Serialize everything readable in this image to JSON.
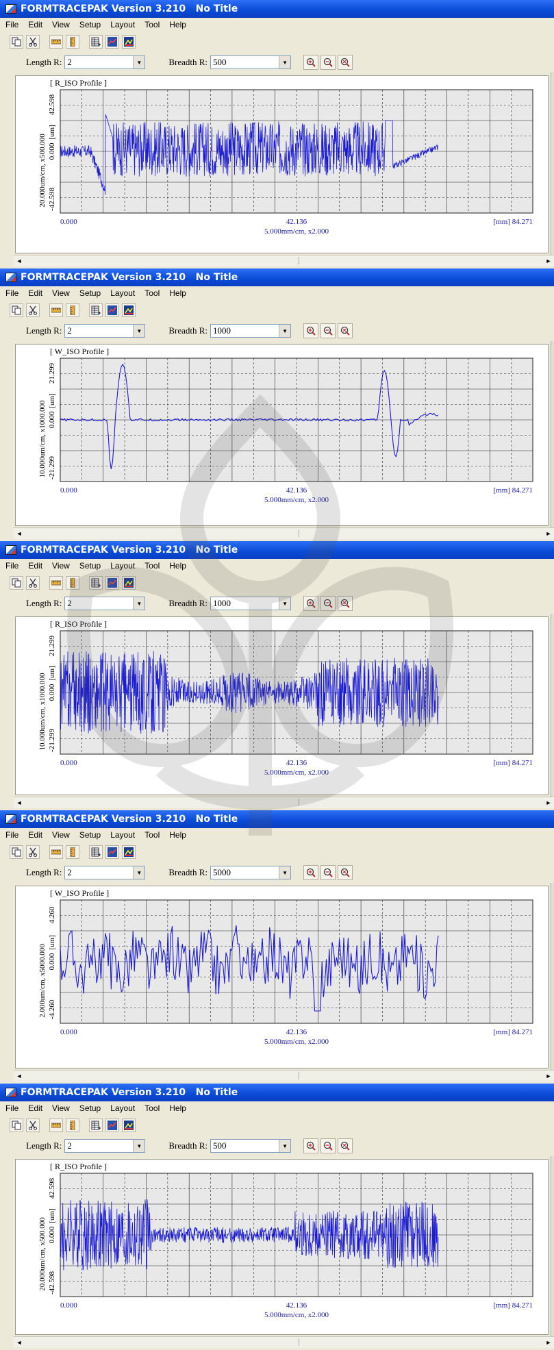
{
  "app": {
    "title": "FORMTRACEPAK Version 3.210   No Title",
    "menu": [
      "File",
      "Edit",
      "View",
      "Setup",
      "Layout",
      "Tool",
      "Help"
    ],
    "length_label": "Length R:",
    "breadth_label": "Breadth R:",
    "toolbar_icons": [
      "copy-icon",
      "cut-icon",
      "ruler-icon",
      "column-icon",
      "table-icon",
      "chart-icon",
      "export-icon"
    ],
    "zoom_icons": [
      "zoom-in-icon",
      "zoom-out-icon",
      "zoom-fit-icon"
    ],
    "colors": {
      "trace": "#1b1bd6",
      "titlebar": "#0a4ad6",
      "grid_bg": "#e8e8e8"
    }
  },
  "windows": [
    {
      "length_value": "2",
      "breadth_value": "500",
      "profile_label": "[ R_ISO Profile ]",
      "ytop": "42.598",
      "ymid": "0.000",
      "ybot": "-42.598",
      "yunit": "[um]",
      "yscale": "20.000um/cm, x500.000",
      "x0": "0.000",
      "xmid": "42.136",
      "xend": "[mm] 84.271",
      "xscale": "5.000mm/cm, x2.000"
    },
    {
      "length_value": "2",
      "breadth_value": "1000",
      "profile_label": "[ W_ISO Profile ]",
      "ytop": "21.299",
      "ymid": "0.000",
      "ybot": "-21.299",
      "yunit": "[um]",
      "yscale": "10.000um/cm, x1000.000",
      "x0": "0.000",
      "xmid": "42.136",
      "xend": "[mm] 84.271",
      "xscale": "5.000mm/cm, x2.000"
    },
    {
      "length_value": "2",
      "breadth_value": "1000",
      "profile_label": "[ R_ISO Profile ]",
      "ytop": "21.299",
      "ymid": "0.000",
      "ybot": "-21.299",
      "yunit": "[um]",
      "yscale": "10.000um/cm, x1000.000",
      "x0": "0.000",
      "xmid": "42.136",
      "xend": "[mm] 84.271",
      "xscale": "5.000mm/cm, x2.000"
    },
    {
      "length_value": "2",
      "breadth_value": "5000",
      "profile_label": "[ W_ISO Profile ]",
      "ytop": "4.260",
      "ymid": "0.000",
      "ybot": "-4.260",
      "yunit": "[um]",
      "yscale": "2.000um/cm, x5000.000",
      "x0": "0.000",
      "xmid": "42.136",
      "xend": "[mm] 84.271",
      "xscale": "5.000mm/cm, x2.000"
    },
    {
      "length_value": "2",
      "breadth_value": "500",
      "profile_label": "[ R_ISO Profile ]",
      "ytop": "42.598",
      "ymid": "0.000",
      "ybot": "-42.598",
      "yunit": "[um]",
      "yscale": "20.000um/cm, x500.000",
      "x0": "0.000",
      "xmid": "42.136",
      "xend": "[mm] 84.271",
      "xscale": "5.000mm/cm, x2.000"
    }
  ]
}
